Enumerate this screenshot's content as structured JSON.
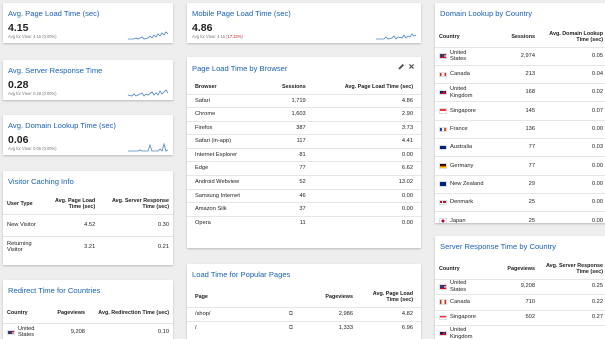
{
  "cards": {
    "page_load": {
      "title": "Avg. Page Load Time (sec)",
      "value": "4.15",
      "avg": "Avg for View: 4.15 (0.00%)"
    },
    "mobile_page_load": {
      "title": "Mobile Page Load Time (sec)",
      "value": "4.86",
      "avg_prefix": "Avg for View: 4.15 (",
      "avg_change": "17.33%",
      "avg_suffix": ")"
    },
    "server_response": {
      "title": "Avg. Server Response Time",
      "value": "0.28",
      "avg": "Avg for View: 0.28 (0.00%)"
    },
    "domain_lookup": {
      "title": "Avg. Domain Lookup Time (sec)",
      "value": "0.06",
      "avg": "Avg for View: 0.06 (0.00%)"
    }
  },
  "visitor_caching": {
    "title": "Visitor Caching Info",
    "headers": [
      "User Type",
      "Avg. Page Load Time (sec)",
      "Avg. Server Response Time (sec)"
    ],
    "rows": [
      [
        "New Visitor",
        "4.52",
        "0.30"
      ],
      [
        "Returning Visitor",
        "3.21",
        "0.21"
      ]
    ]
  },
  "redirect": {
    "title": "Redirect Time for Countries",
    "headers": [
      "Country",
      "Pageviews",
      "Avg. Redirection Time (sec)"
    ],
    "rows": [
      {
        "country": "United States",
        "flag": "us",
        "pageviews": "9,208",
        "value": "0.10"
      }
    ]
  },
  "browser": {
    "title": "Page Load Time by Browser",
    "headers": [
      "Browser",
      "Sessions",
      "Avg. Page Load Time (sec)"
    ],
    "rows": [
      [
        "Safari",
        "1,719",
        "4.86"
      ],
      [
        "Chrome",
        "1,603",
        "2.90"
      ],
      [
        "Firefox",
        "387",
        "3.73"
      ],
      [
        "Safari (in-app)",
        "117",
        "4.41"
      ],
      [
        "Internet Explorer",
        "81",
        "0.00"
      ],
      [
        "Edge",
        "77",
        "6.62"
      ],
      [
        "Android Webview",
        "52",
        "13.02"
      ],
      [
        "Samsung Internet",
        "46",
        "0.00"
      ],
      [
        "Amazon Silk",
        "37",
        "0.00"
      ],
      [
        "Opera",
        "11",
        "0.00"
      ]
    ]
  },
  "popular_pages": {
    "title": "Load Time for Popular Pages",
    "headers": [
      "Page",
      "Pageviews",
      "Avg. Page Load Time (sec)"
    ],
    "rows": [
      [
        "/shop/",
        "2,986",
        "4.82"
      ],
      [
        "/",
        "1,333",
        "6.96"
      ]
    ]
  },
  "domain_country": {
    "title": "Domain Lookup by Country",
    "headers": [
      "Country",
      "Sessions",
      "Avg. Domain Lookup Time (sec)"
    ],
    "rows": [
      {
        "country": "United States",
        "flag": "us",
        "sessions": "2,974",
        "value": "0.05"
      },
      {
        "country": "Canada",
        "flag": "ca",
        "sessions": "213",
        "value": "0.04"
      },
      {
        "country": "United Kingdom",
        "flag": "uk",
        "sessions": "168",
        "value": "0.02"
      },
      {
        "country": "Singapore",
        "flag": "sg",
        "sessions": "145",
        "value": "0.07"
      },
      {
        "country": "France",
        "flag": "fr",
        "sessions": "136",
        "value": "0.00"
      },
      {
        "country": "Australia",
        "flag": "au",
        "sessions": "77",
        "value": "0.03"
      },
      {
        "country": "Germany",
        "flag": "de",
        "sessions": "77",
        "value": "0.00"
      },
      {
        "country": "New Zealand",
        "flag": "nz",
        "sessions": "29",
        "value": "0.00"
      },
      {
        "country": "Denmark",
        "flag": "dk",
        "sessions": "25",
        "value": "0.00"
      },
      {
        "country": "Japan",
        "flag": "jp",
        "sessions": "25",
        "value": "0.00"
      }
    ]
  },
  "server_country": {
    "title": "Server Response Time by Country",
    "headers": [
      "Country",
      "Pageviews",
      "Avg. Server Response Time (sec)"
    ],
    "rows": [
      {
        "country": "United States",
        "flag": "us",
        "pageviews": "9,208",
        "value": "0.25"
      },
      {
        "country": "Canada",
        "flag": "ca",
        "pageviews": "710",
        "value": "0.22"
      },
      {
        "country": "Singapore",
        "flag": "sg",
        "pageviews": "502",
        "value": "0.27"
      },
      {
        "country": "United Kingdom",
        "flag": "uk",
        "pageviews": "",
        "value": ""
      }
    ]
  },
  "icons": {
    "edit": "edit-icon",
    "close": "close-icon",
    "link": "open-link-icon"
  },
  "colors": {
    "title_blue": "#1a62b5",
    "spark_blue": "#4a86c8",
    "negative": "#c5221f"
  }
}
